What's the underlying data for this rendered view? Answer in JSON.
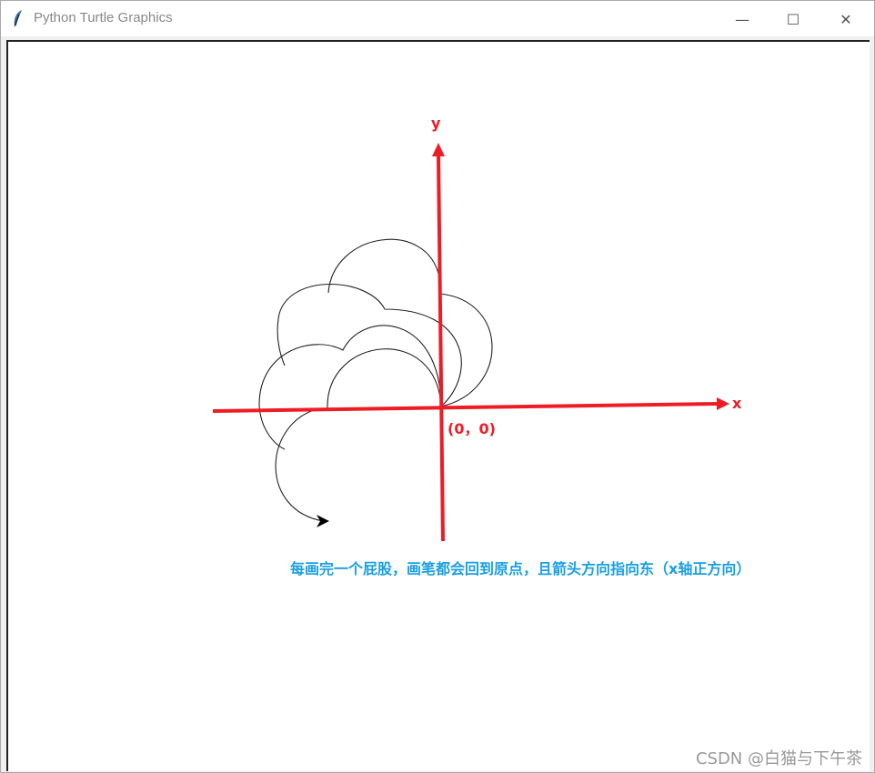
{
  "window": {
    "title": "Python Turtle Graphics",
    "icon": "feather-icon",
    "minimize": "—",
    "maximize": "☐",
    "close": "✕"
  },
  "diagram": {
    "x_label": "x",
    "y_label": "y",
    "origin_label": "(0，0)",
    "caption": "每画完一个屁股，画笔都会回到原点，且箭头方向指向东（x轴正方向）",
    "axis_color": "#ee1c25",
    "caption_color": "#1a9fe0"
  },
  "watermark": "CSDN @白猫与下午茶"
}
